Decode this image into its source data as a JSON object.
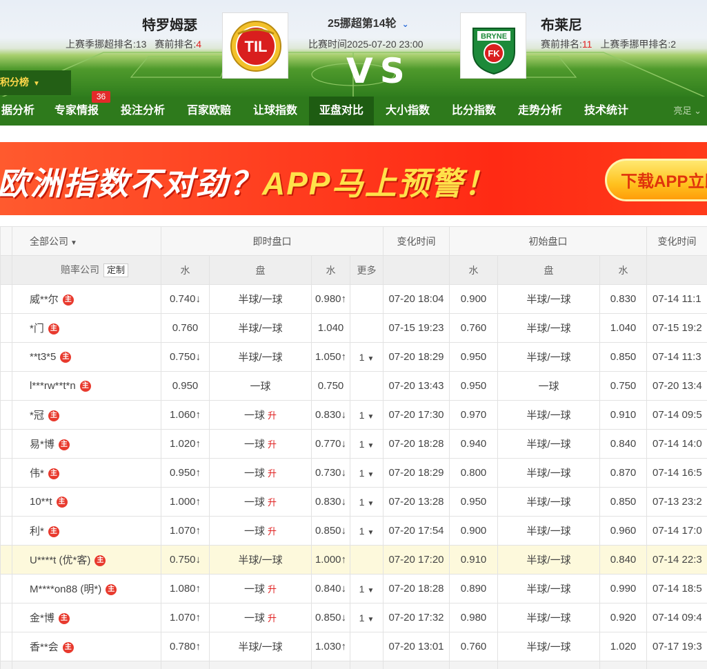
{
  "match": {
    "round": "25挪超第14轮",
    "time": "比赛时间2025-07-20 23:00",
    "vs": "VS",
    "home": {
      "name": "特罗姆瑟",
      "last_season_label": "上赛季挪超排名:13",
      "pre_rank_label": "赛前排名:",
      "pre_rank_value": "4",
      "logo_text": "TIL"
    },
    "away": {
      "name": "布莱尼",
      "pre_rank_label": "赛前排名:",
      "pre_rank_value": "11",
      "last_season_label": "上赛季挪甲排名:2",
      "logo_text_top": "BRYNE",
      "logo_text_mid": "FK"
    }
  },
  "standings_button": "前积分榜",
  "nav": {
    "items": [
      "据分析",
      "专家情报",
      "投注分析",
      "百家欧赔",
      "让球指数",
      "亚盘对比",
      "大小指数",
      "比分指数",
      "走势分析",
      "技术统计"
    ],
    "active_index": 5,
    "badge": "36",
    "more": "亮足"
  },
  "banner": {
    "text_white": "欧洲指数不对劲？",
    "text_yellow": "APP马上预警！",
    "button": "下载APP立即"
  },
  "table": {
    "headers": {
      "company_filter": "全部公司",
      "live": "即时盘口",
      "change_time": "变化时间",
      "initial": "初始盘口",
      "change_time2": "变化时间",
      "odds_company": "赔率公司",
      "custom": "定制",
      "water": "水",
      "line": "盘",
      "more": "更多"
    },
    "icon_glyph": "主",
    "rows": [
      {
        "company": "威**尔",
        "w1": "0.740",
        "d1": "down",
        "line": "半球/一球",
        "rise": "",
        "w2": "0.980",
        "d2": "up",
        "more": "",
        "time": "07-20 18:04",
        "iw1": "0.900",
        "iline": "半球/一球",
        "iw2": "0.830",
        "itime": "07-14 11:1",
        "hl": false
      },
      {
        "company": "*门",
        "w1": "0.760",
        "d1": "",
        "line": "半球/一球",
        "rise": "",
        "w2": "1.040",
        "d2": "",
        "more": "",
        "time": "07-15 19:23",
        "iw1": "0.760",
        "iline": "半球/一球",
        "iw2": "1.040",
        "itime": "07-15 19:2",
        "hl": false
      },
      {
        "company": "**t3*5",
        "w1": "0.750",
        "d1": "down",
        "line": "半球/一球",
        "rise": "",
        "w2": "1.050",
        "d2": "up",
        "more": "1",
        "time": "07-20 18:29",
        "iw1": "0.950",
        "iline": "半球/一球",
        "iw2": "0.850",
        "itime": "07-14 11:3",
        "hl": false
      },
      {
        "company": "l***rw**t*n",
        "w1": "0.950",
        "d1": "",
        "line": "一球",
        "rise": "",
        "w2": "0.750",
        "d2": "",
        "more": "",
        "time": "07-20 13:43",
        "iw1": "0.950",
        "iline": "一球",
        "iw2": "0.750",
        "itime": "07-20 13:4",
        "hl": false
      },
      {
        "company": "*冠",
        "w1": "1.060",
        "d1": "up",
        "line": "一球",
        "rise": "升",
        "w2": "0.830",
        "d2": "down",
        "more": "1",
        "time": "07-20 17:30",
        "iw1": "0.970",
        "iline": "半球/一球",
        "iw2": "0.910",
        "itime": "07-14 09:5",
        "hl": false
      },
      {
        "company": "易*博",
        "w1": "1.020",
        "d1": "up",
        "line": "一球",
        "rise": "升",
        "w2": "0.770",
        "d2": "down",
        "more": "1",
        "time": "07-20 18:28",
        "iw1": "0.940",
        "iline": "半球/一球",
        "iw2": "0.840",
        "itime": "07-14 14:0",
        "hl": false
      },
      {
        "company": "伟*",
        "w1": "0.950",
        "d1": "up",
        "line": "一球",
        "rise": "升",
        "w2": "0.730",
        "d2": "down",
        "more": "1",
        "time": "07-20 18:29",
        "iw1": "0.800",
        "iline": "半球/一球",
        "iw2": "0.870",
        "itime": "07-14 16:5",
        "hl": false
      },
      {
        "company": "10**t",
        "w1": "1.000",
        "d1": "up",
        "line": "一球",
        "rise": "升",
        "w2": "0.830",
        "d2": "down",
        "more": "1",
        "time": "07-20 13:28",
        "iw1": "0.950",
        "iline": "半球/一球",
        "iw2": "0.850",
        "itime": "07-13 23:2",
        "hl": false
      },
      {
        "company": "利*",
        "w1": "1.070",
        "d1": "up",
        "line": "一球",
        "rise": "升",
        "w2": "0.850",
        "d2": "down",
        "more": "1",
        "time": "07-20 17:54",
        "iw1": "0.900",
        "iline": "半球/一球",
        "iw2": "0.960",
        "itime": "07-14 17:0",
        "hl": false
      },
      {
        "company": "U****t (优*客)",
        "w1": "0.750",
        "d1": "down",
        "line": "半球/一球",
        "rise": "",
        "w2": "1.000",
        "d2": "up",
        "more": "",
        "time": "07-20 17:20",
        "iw1": "0.910",
        "iline": "半球/一球",
        "iw2": "0.840",
        "itime": "07-14 22:3",
        "hl": true
      },
      {
        "company": "M****on88 (明*)",
        "w1": "1.080",
        "d1": "up",
        "line": "一球",
        "rise": "升",
        "w2": "0.840",
        "d2": "down",
        "more": "1",
        "time": "07-20 18:28",
        "iw1": "0.890",
        "iline": "半球/一球",
        "iw2": "0.990",
        "itime": "07-14 18:5",
        "hl": false
      },
      {
        "company": "金*博",
        "w1": "1.070",
        "d1": "up",
        "line": "一球",
        "rise": "升",
        "w2": "0.850",
        "d2": "down",
        "more": "1",
        "time": "07-20 17:32",
        "iw1": "0.980",
        "iline": "半球/一球",
        "iw2": "0.920",
        "itime": "07-14 09:4",
        "hl": false
      },
      {
        "company": "香**会",
        "w1": "0.780",
        "d1": "up",
        "line": "半球/一球",
        "rise": "",
        "w2": "1.030",
        "d2": "up",
        "more": "",
        "time": "07-20 13:01",
        "iw1": "0.760",
        "iline": "半球/一球",
        "iw2": "1.020",
        "itime": "07-17 19:3",
        "hl": false
      }
    ]
  },
  "colors": {
    "up": "#e02020",
    "down": "#2a9a1e",
    "nav_bg": "#2e7a1c",
    "highlight_row": "#fdf9dc"
  }
}
